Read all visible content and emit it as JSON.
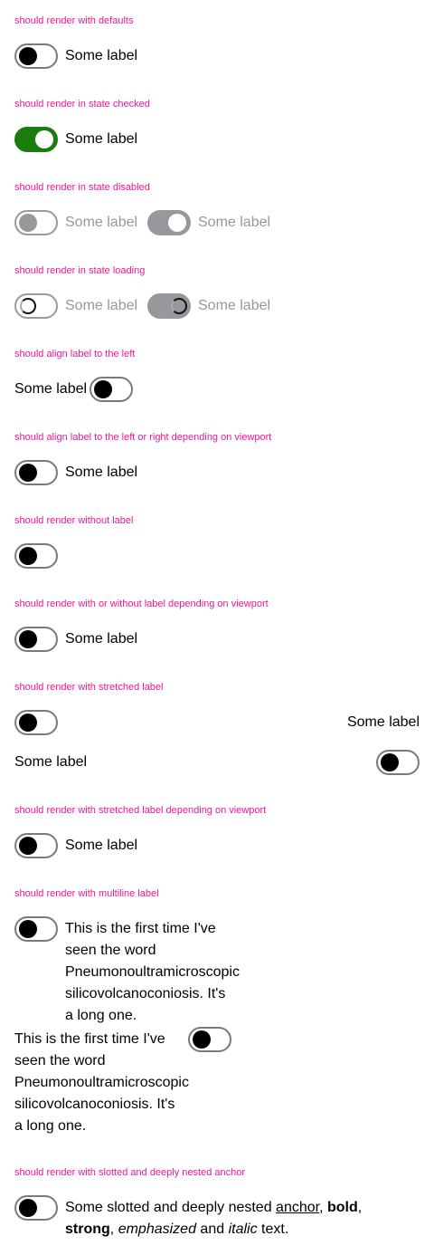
{
  "headings": [
    "should render with defaults",
    "should render in state checked",
    "should render in state disabled",
    "should render in state loading",
    "should align label to the left",
    "should align label to the left or right depending on viewport",
    "should render without label",
    "should render with or without label depending on viewport",
    "should render with stretched label",
    "should render with stretched label depending on viewport",
    "should render with multiline label",
    "should render with slotted and deeply nested anchor"
  ],
  "label": "Some label",
  "multiline": "This is the first time I've seen the word Pneumonoultramicroscopic silicovolcanoconiosis. It's a long one.",
  "slotted": {
    "prefix": "Some slotted and deeply nested ",
    "anchor": "anchor",
    "sep1": ", ",
    "bold": "bold",
    "sep2": ", ",
    "strong": "strong",
    "sep3": ",",
    "em": "emphasized",
    "mid": " and ",
    "italic": "italic",
    "suffix": " text."
  },
  "colors": {
    "heading": "#f0179a",
    "checked": "#1a7d10",
    "disabled": "#98989c"
  }
}
